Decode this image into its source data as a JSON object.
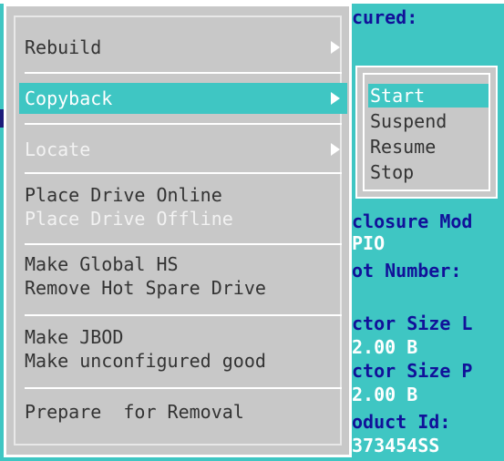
{
  "background_text": [
    {
      "text": "cured:",
      "style": "dark"
    },
    {
      "text": "closure Mod",
      "style": "dark"
    },
    {
      "text": "PIO",
      "style": "light"
    },
    {
      "text": "ot Number:",
      "style": "dark"
    },
    {
      "text": "ctor Size L",
      "style": "dark"
    },
    {
      "text": "2.00 B",
      "style": "light"
    },
    {
      "text": "ctor Size P",
      "style": "dark"
    },
    {
      "text": "2.00 B",
      "style": "light"
    },
    {
      "text": "oduct Id:",
      "style": "dark"
    },
    {
      "text": "373454SS",
      "style": "light"
    }
  ],
  "menu": {
    "items": [
      {
        "label": "Rebuild",
        "state": "enabled",
        "has_submenu": true
      },
      {
        "label": "Copyback",
        "state": "selected",
        "has_submenu": true
      },
      {
        "label": "Locate",
        "state": "disabled",
        "has_submenu": true
      },
      {
        "label": "Place Drive Online",
        "state": "enabled",
        "has_submenu": false
      },
      {
        "label": "Place Drive Offline",
        "state": "disabled",
        "has_submenu": false
      },
      {
        "label": "Make Global HS",
        "state": "enabled",
        "has_submenu": false
      },
      {
        "label": "Remove Hot Spare Drive",
        "state": "enabled",
        "has_submenu": false
      },
      {
        "label": "Make JBOD",
        "state": "enabled",
        "has_submenu": false
      },
      {
        "label": "Make unconfigured good",
        "state": "enabled",
        "has_submenu": false
      },
      {
        "label": "Prepare  for Removal",
        "state": "enabled",
        "has_submenu": false
      }
    ]
  },
  "submenu": {
    "items": [
      {
        "label": "Start",
        "state": "selected"
      },
      {
        "label": "Suspend",
        "state": "enabled"
      },
      {
        "label": "Resume",
        "state": "enabled"
      },
      {
        "label": "Stop",
        "state": "enabled"
      }
    ]
  },
  "colors": {
    "background": "#3fc6c3",
    "menu_bg": "#c8c8c8",
    "highlight": "#3fc6c3",
    "text_dark": "#111199",
    "menu_text": "#333333",
    "disabled_text": "#f2f2f2"
  },
  "icons": {
    "submenu_arrow": "triangle-right-icon"
  }
}
